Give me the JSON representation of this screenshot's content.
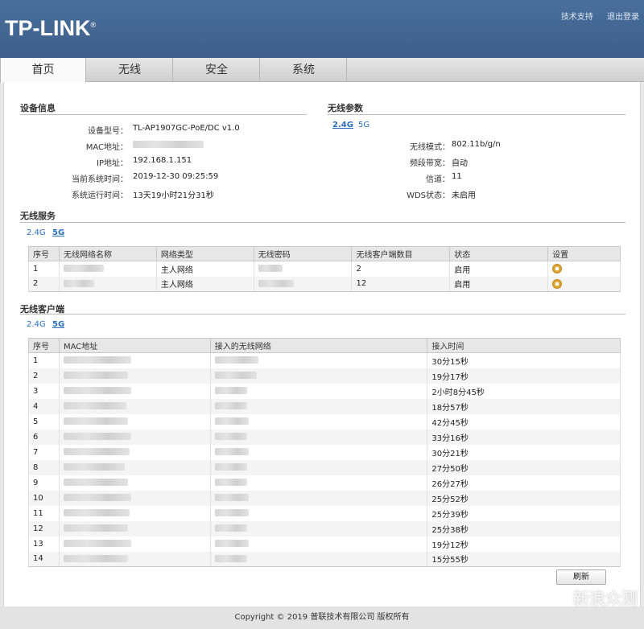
{
  "brand": {
    "logo_text": "TP-LINK",
    "logo_mark": "®"
  },
  "toplinks": {
    "support": "技术支持",
    "logout": "退出登录"
  },
  "tabs": [
    "首页",
    "无线",
    "安全",
    "系统"
  ],
  "device_info": {
    "title": "设备信息",
    "rows": [
      {
        "label": "设备型号：",
        "value": "TL-AP1907GC-PoE/DC v1.0"
      },
      {
        "label": "MAC地址：",
        "value": ""
      },
      {
        "label": "IP地址：",
        "value": "192.168.1.151"
      },
      {
        "label": "当前系统时间：",
        "value": "2019-12-30 09:25:59"
      },
      {
        "label": "系统运行时间：",
        "value": "13天19小时21分31秒"
      }
    ]
  },
  "wireless_params": {
    "title": "无线参数",
    "bands": [
      "2.4G",
      "5G"
    ],
    "rows": [
      {
        "label": "无线模式：",
        "value": "802.11b/g/n"
      },
      {
        "label": "频段带宽：",
        "value": "自动"
      },
      {
        "label": "信道：",
        "value": "11"
      },
      {
        "label": "WDS状态：",
        "value": "未启用"
      }
    ]
  },
  "wireless_service": {
    "title": "无线服务",
    "bands": [
      "2.4G",
      "5G"
    ],
    "headers": [
      "序号",
      "无线网络名称",
      "网络类型",
      "无线密码",
      "无线客户端数目",
      "状态",
      "设置"
    ],
    "rows": [
      {
        "no": "1",
        "type": "主人网络",
        "clients": "2",
        "status": "启用"
      },
      {
        "no": "2",
        "type": "主人网络",
        "clients": "12",
        "status": "启用"
      }
    ]
  },
  "wireless_clients": {
    "title": "无线客户端",
    "bands": [
      "2.4G",
      "5G"
    ],
    "headers": [
      "序号",
      "MAC地址",
      "接入的无线网络",
      "接入时间"
    ],
    "rows": [
      {
        "no": "1",
        "time": "30分15秒"
      },
      {
        "no": "2",
        "time": "19分17秒"
      },
      {
        "no": "3",
        "time": "2小时8分45秒"
      },
      {
        "no": "4",
        "time": "18分57秒"
      },
      {
        "no": "5",
        "time": "42分45秒"
      },
      {
        "no": "6",
        "time": "33分16秒"
      },
      {
        "no": "7",
        "time": "30分21秒"
      },
      {
        "no": "8",
        "time": "27分50秒"
      },
      {
        "no": "9",
        "time": "26分27秒"
      },
      {
        "no": "10",
        "time": "25分52秒"
      },
      {
        "no": "11",
        "time": "25分39秒"
      },
      {
        "no": "12",
        "time": "25分38秒"
      },
      {
        "no": "13",
        "time": "19分12秒"
      },
      {
        "no": "14",
        "time": "15分55秒"
      }
    ]
  },
  "refresh_label": "刷新",
  "footer": "Copyright © 2019 普联技术有限公司 版权所有",
  "watermark": "新浪众测",
  "colors": {
    "header_blue": "#4a6f9c",
    "link_blue": "#2a6ebd"
  }
}
